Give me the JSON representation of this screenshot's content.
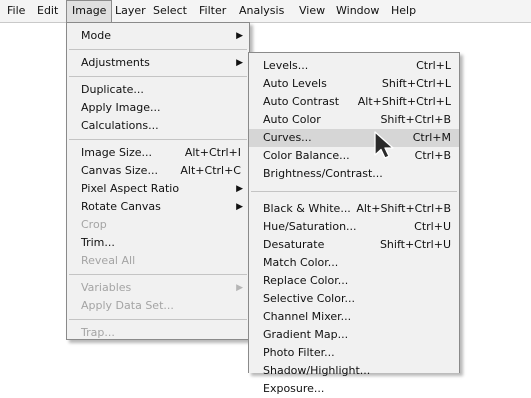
{
  "menubar": {
    "items": [
      "File",
      "Edit",
      "Image",
      "Layer",
      "Select",
      "Filter",
      "Analysis",
      "View",
      "Window",
      "Help"
    ]
  },
  "image_menu": {
    "mode": "Mode",
    "adjustments": "Adjustments",
    "duplicate": "Duplicate...",
    "apply_image": "Apply Image...",
    "calculations": "Calculations...",
    "image_size": {
      "label": "Image Size...",
      "shortcut": "Alt+Ctrl+I"
    },
    "canvas_size": {
      "label": "Canvas Size...",
      "shortcut": "Alt+Ctrl+C"
    },
    "pixel_aspect_ratio": "Pixel Aspect Ratio",
    "rotate_canvas": "Rotate Canvas",
    "crop": "Crop",
    "trim": "Trim...",
    "reveal_all": "Reveal All",
    "variables": "Variables",
    "apply_data_set": "Apply Data Set...",
    "trap": "Trap..."
  },
  "adjustments_menu": {
    "levels": {
      "label": "Levels...",
      "shortcut": "Ctrl+L"
    },
    "auto_levels": {
      "label": "Auto Levels",
      "shortcut": "Shift+Ctrl+L"
    },
    "auto_contrast": {
      "label": "Auto Contrast",
      "shortcut": "Alt+Shift+Ctrl+L"
    },
    "auto_color": {
      "label": "Auto Color",
      "shortcut": "Shift+Ctrl+B"
    },
    "curves": {
      "label": "Curves...",
      "shortcut": "Ctrl+M"
    },
    "color_balance": {
      "label": "Color Balance...",
      "shortcut": "Ctrl+B"
    },
    "brightness_contrast": {
      "label": "Brightness/Contrast...",
      "shortcut": ""
    },
    "black_white": {
      "label": "Black & White...",
      "shortcut": "Alt+Shift+Ctrl+B"
    },
    "hue_saturation": {
      "label": "Hue/Saturation...",
      "shortcut": "Ctrl+U"
    },
    "desaturate": {
      "label": "Desaturate",
      "shortcut": "Shift+Ctrl+U"
    },
    "match_color": "Match Color...",
    "replace_color": "Replace Color...",
    "selective_color": "Selective Color...",
    "channel_mixer": "Channel Mixer...",
    "gradient_map": "Gradient Map...",
    "photo_filter": "Photo Filter...",
    "shadow_highlight": "Shadow/Highlight...",
    "exposure": "Exposure..."
  },
  "colors": {
    "menu_bg": "#f1f1f1",
    "highlight": "#d6d6d6",
    "disabled_text": "#a4a4a4",
    "border": "#8a8a8a"
  },
  "icons": [
    "submenu-arrow-icon",
    "mouse-pointer-icon"
  ]
}
